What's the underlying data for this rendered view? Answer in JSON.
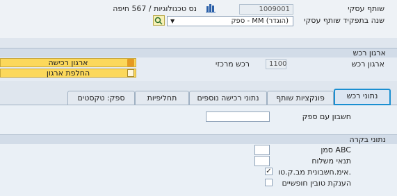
{
  "header": {
    "partner_label": "שותף עסקי",
    "partner_value": "1009001",
    "partner_desc": "נס טכנולוגיות / 567 חיפה",
    "role_label": "שנה בתפקיד שותף עסקי",
    "role_value": "ספק - MM (הוגדר)"
  },
  "purch_org": {
    "section_title": "ארגון רכש",
    "org_label": "ארגון רכש",
    "org_value": "1100",
    "central_label": "רכש מרכזי",
    "btn_org": "ארגון רכישה",
    "btn_switch": "החלפת ארגון"
  },
  "tabs": [
    {
      "label": "נתוני רכש"
    },
    {
      "label": "פונקציות שותף"
    },
    {
      "label": "נתוני רכישה נוספים"
    },
    {
      "label": "תחליפיות"
    },
    {
      "label": "ספק: טקסטים"
    }
  ],
  "account": {
    "label": "חשבון עם ספק",
    "value": ""
  },
  "control": {
    "section_title": "נתוני בקרה",
    "abc_label": "סמן ABC",
    "abc_value": "",
    "shipping_label": "תנאי משלוח",
    "shipping_value": "",
    "gr_iv_label": "אימ.חשבונית מב.ק.טו.",
    "gr_iv_checked": "✓",
    "grant_label": "הענקת טובין חופשיים",
    "grant_checked": ""
  },
  "colors": {
    "accent": "#1a8fd1",
    "button": "#fcd85b",
    "section": "#d2dce8"
  }
}
